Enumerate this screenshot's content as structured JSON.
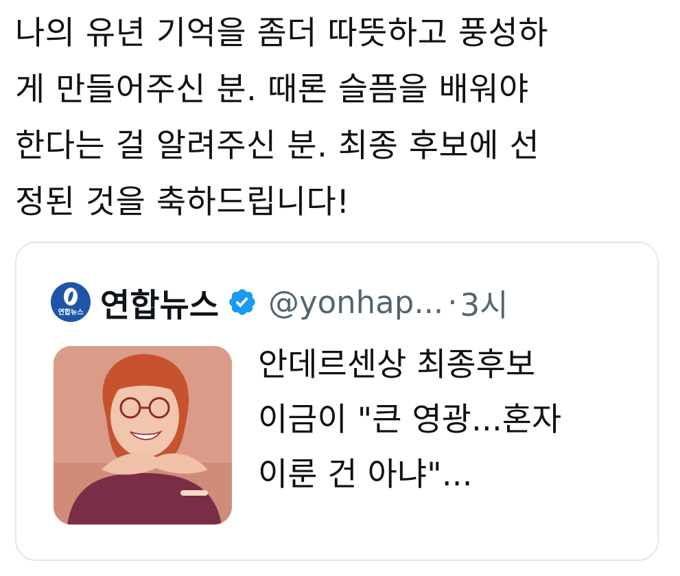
{
  "tweet": {
    "text_lines": [
      "나의 유년 기억을 좀더 따뜻하고 풍성하",
      "게 만들어주신 분. 때론 슬픔을 배워야",
      "한다는 걸 알려주신 분. 최종 후보에 선",
      "정된 것을 축하드립니다!"
    ]
  },
  "quoted_tweet": {
    "avatar_label": "연합뉴스",
    "display_name": "연합뉴스",
    "handle": "@yonhap...",
    "separator": "·",
    "time": "3시",
    "verified_icon": "verified-badge-icon",
    "article_lines": [
      "안데르센상 최종후보",
      "이금이 \"큰 영광...혼자",
      "이룬 건 아냐\"..."
    ]
  },
  "colors": {
    "text": "#111111",
    "secondary_text": "#536471",
    "border": "#e3e6e8",
    "verified": "#1d9bf0",
    "logo": "#1f55a8"
  }
}
